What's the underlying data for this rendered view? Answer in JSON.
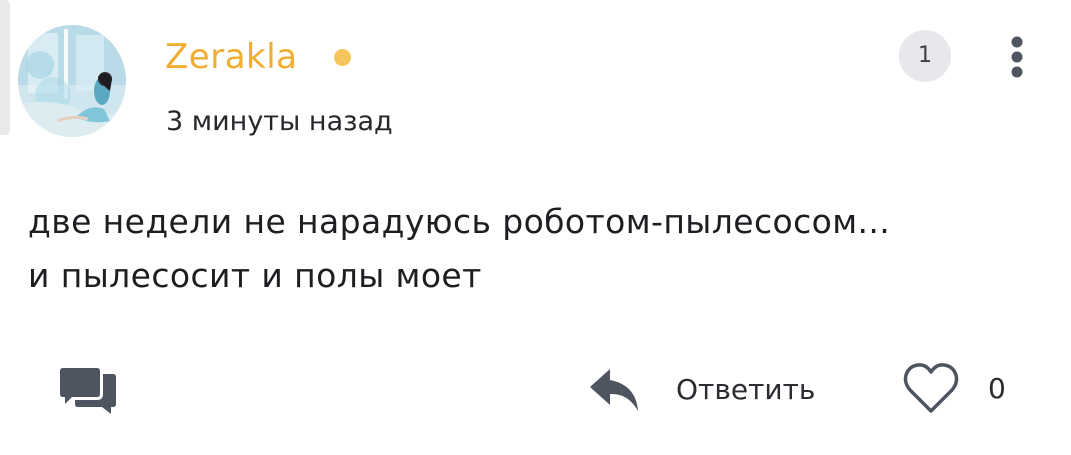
{
  "comment": {
    "author": "Zerakla",
    "time": "3 минуты назад",
    "text": "две недели не нарадуюсь роботом-пылесосом...\nи пылесосит и полы моет",
    "reply_count": "1",
    "like_count": "0",
    "online": true
  },
  "actions": {
    "reply_label": "Ответить"
  },
  "icons": {
    "thread": "chat-bubbles-icon",
    "reply": "reply-arrow-icon",
    "like": "heart-outline-icon",
    "more": "vertical-dots-icon"
  },
  "colors": {
    "username": "#f0ad2f",
    "online_dot": "#f6c55c",
    "icon": "#4f5560",
    "badge_bg": "#e8e8ec",
    "text": "#1d1e22"
  }
}
